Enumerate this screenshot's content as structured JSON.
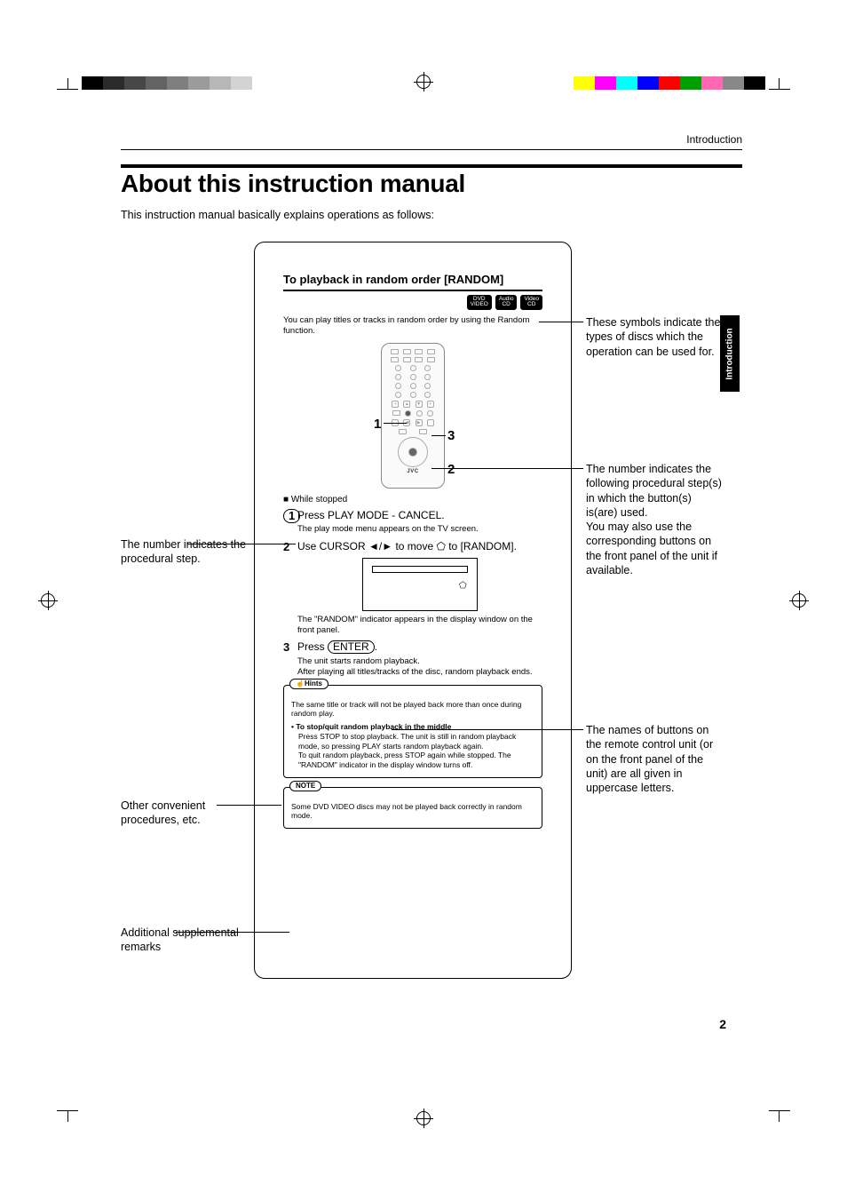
{
  "running_head": "Introduction",
  "page_title": "About this instruction manual",
  "intro_line": "This instruction manual basically explains operations as follows:",
  "side_tab": "Introduction",
  "sample": {
    "title": "To playback in random order [RANDOM]",
    "disc_badges": [
      {
        "line1": "DVD",
        "line2": "VIDEO"
      },
      {
        "line1": "Audio",
        "line2": "CD"
      },
      {
        "line1": "Video",
        "line2": "CD"
      }
    ],
    "intro": "You can play titles or tracks in random order by using the Random function.",
    "remote_brand": "JVC",
    "remote_callout_1": "1",
    "remote_callout_2": "2",
    "remote_callout_3": "3",
    "condition": "While stopped",
    "steps": [
      {
        "num": "1",
        "body_pre": "Press ",
        "btn": "PLAY MODE - CANCEL",
        "body_post": ".",
        "sub": "The play mode menu appears on the TV screen."
      },
      {
        "num": "2",
        "body_pre": "Use CURSOR ",
        "arrows": "◄/►",
        "body_mid": " to move ⬠ to ",
        "target": "[RANDOM]",
        "body_post": ".",
        "sub": "The \"RANDOM\" indicator appears in the display window on the front panel."
      },
      {
        "num": "3",
        "body_pre": "Press ",
        "btn": "ENTER",
        "body_post": ".",
        "sub": "The unit starts random playback.\n After playing all titles/tracks of the disc, random playback ends."
      }
    ],
    "hints_tab": "Hints",
    "hint1": "The same title or track will not be played back more than once during random play.",
    "hint2_title": "To stop/quit random playback in the middle",
    "hint2_body": "Press STOP to stop playback. The unit is still in random playback mode, so pressing PLAY starts random playback again.\nTo quit random playback, press STOP again while stopped.  The \"RANDOM\" indicator in the display window turns off.",
    "note_tab": "NOTE",
    "note_body": "Some DVD VIDEO discs may not be played back correctly in random mode."
  },
  "callouts": {
    "left_step": "The number indicates the procedural step.",
    "left_hints": "Other convenient procedures, etc.",
    "left_note": "Additional supplemental remarks",
    "right_discs": "These symbols indicate the types of discs which the operation can be used for.",
    "right_remote": "The number indicates the following procedural step(s) in which the button(s) is(are) used.\nYou may also use the corresponding buttons on the front panel of the unit if available.",
    "right_names": "The names of buttons on the remote control unit (or on the front panel of the unit) are all given in uppercase letters."
  },
  "page_number": "2",
  "colorbars": {
    "left": [
      "#000",
      "#2b2b2b",
      "#474747",
      "#636363",
      "#7f7f7f",
      "#9b9b9b",
      "#b7b7b7",
      "#d3d3d3",
      "#fff"
    ],
    "right": [
      "#ffff00",
      "#ff00ff",
      "#00ffff",
      "#0000ff",
      "#ff0000",
      "#00a000",
      "#ff69b4",
      "#888",
      "#000"
    ]
  }
}
